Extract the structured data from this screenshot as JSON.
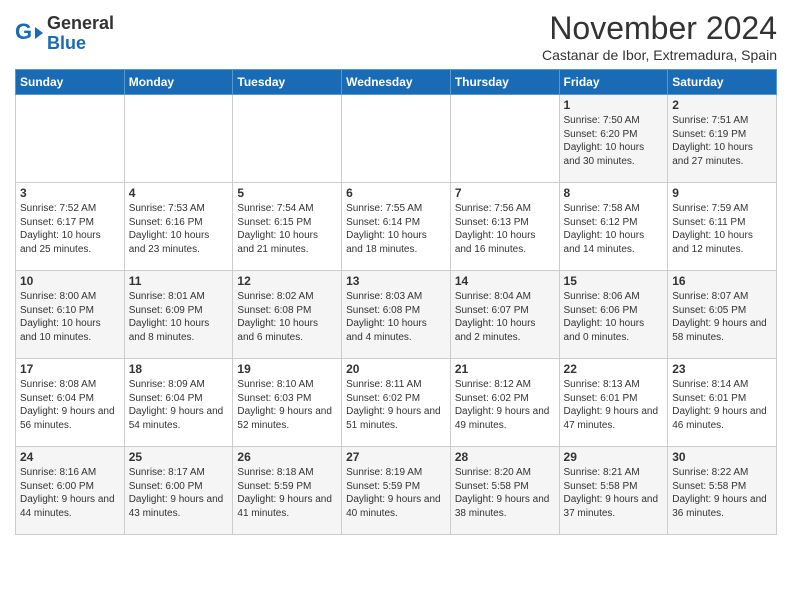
{
  "header": {
    "logo_general": "General",
    "logo_blue": "Blue",
    "title": "November 2024",
    "location": "Castanar de Ibor, Extremadura, Spain"
  },
  "days_of_week": [
    "Sunday",
    "Monday",
    "Tuesday",
    "Wednesday",
    "Thursday",
    "Friday",
    "Saturday"
  ],
  "weeks": [
    [
      {
        "day": "",
        "info": ""
      },
      {
        "day": "",
        "info": ""
      },
      {
        "day": "",
        "info": ""
      },
      {
        "day": "",
        "info": ""
      },
      {
        "day": "",
        "info": ""
      },
      {
        "day": "1",
        "info": "Sunrise: 7:50 AM\nSunset: 6:20 PM\nDaylight: 10 hours and 30 minutes."
      },
      {
        "day": "2",
        "info": "Sunrise: 7:51 AM\nSunset: 6:19 PM\nDaylight: 10 hours and 27 minutes."
      }
    ],
    [
      {
        "day": "3",
        "info": "Sunrise: 7:52 AM\nSunset: 6:17 PM\nDaylight: 10 hours and 25 minutes."
      },
      {
        "day": "4",
        "info": "Sunrise: 7:53 AM\nSunset: 6:16 PM\nDaylight: 10 hours and 23 minutes."
      },
      {
        "day": "5",
        "info": "Sunrise: 7:54 AM\nSunset: 6:15 PM\nDaylight: 10 hours and 21 minutes."
      },
      {
        "day": "6",
        "info": "Sunrise: 7:55 AM\nSunset: 6:14 PM\nDaylight: 10 hours and 18 minutes."
      },
      {
        "day": "7",
        "info": "Sunrise: 7:56 AM\nSunset: 6:13 PM\nDaylight: 10 hours and 16 minutes."
      },
      {
        "day": "8",
        "info": "Sunrise: 7:58 AM\nSunset: 6:12 PM\nDaylight: 10 hours and 14 minutes."
      },
      {
        "day": "9",
        "info": "Sunrise: 7:59 AM\nSunset: 6:11 PM\nDaylight: 10 hours and 12 minutes."
      }
    ],
    [
      {
        "day": "10",
        "info": "Sunrise: 8:00 AM\nSunset: 6:10 PM\nDaylight: 10 hours and 10 minutes."
      },
      {
        "day": "11",
        "info": "Sunrise: 8:01 AM\nSunset: 6:09 PM\nDaylight: 10 hours and 8 minutes."
      },
      {
        "day": "12",
        "info": "Sunrise: 8:02 AM\nSunset: 6:08 PM\nDaylight: 10 hours and 6 minutes."
      },
      {
        "day": "13",
        "info": "Sunrise: 8:03 AM\nSunset: 6:08 PM\nDaylight: 10 hours and 4 minutes."
      },
      {
        "day": "14",
        "info": "Sunrise: 8:04 AM\nSunset: 6:07 PM\nDaylight: 10 hours and 2 minutes."
      },
      {
        "day": "15",
        "info": "Sunrise: 8:06 AM\nSunset: 6:06 PM\nDaylight: 10 hours and 0 minutes."
      },
      {
        "day": "16",
        "info": "Sunrise: 8:07 AM\nSunset: 6:05 PM\nDaylight: 9 hours and 58 minutes."
      }
    ],
    [
      {
        "day": "17",
        "info": "Sunrise: 8:08 AM\nSunset: 6:04 PM\nDaylight: 9 hours and 56 minutes."
      },
      {
        "day": "18",
        "info": "Sunrise: 8:09 AM\nSunset: 6:04 PM\nDaylight: 9 hours and 54 minutes."
      },
      {
        "day": "19",
        "info": "Sunrise: 8:10 AM\nSunset: 6:03 PM\nDaylight: 9 hours and 52 minutes."
      },
      {
        "day": "20",
        "info": "Sunrise: 8:11 AM\nSunset: 6:02 PM\nDaylight: 9 hours and 51 minutes."
      },
      {
        "day": "21",
        "info": "Sunrise: 8:12 AM\nSunset: 6:02 PM\nDaylight: 9 hours and 49 minutes."
      },
      {
        "day": "22",
        "info": "Sunrise: 8:13 AM\nSunset: 6:01 PM\nDaylight: 9 hours and 47 minutes."
      },
      {
        "day": "23",
        "info": "Sunrise: 8:14 AM\nSunset: 6:01 PM\nDaylight: 9 hours and 46 minutes."
      }
    ],
    [
      {
        "day": "24",
        "info": "Sunrise: 8:16 AM\nSunset: 6:00 PM\nDaylight: 9 hours and 44 minutes."
      },
      {
        "day": "25",
        "info": "Sunrise: 8:17 AM\nSunset: 6:00 PM\nDaylight: 9 hours and 43 minutes."
      },
      {
        "day": "26",
        "info": "Sunrise: 8:18 AM\nSunset: 5:59 PM\nDaylight: 9 hours and 41 minutes."
      },
      {
        "day": "27",
        "info": "Sunrise: 8:19 AM\nSunset: 5:59 PM\nDaylight: 9 hours and 40 minutes."
      },
      {
        "day": "28",
        "info": "Sunrise: 8:20 AM\nSunset: 5:58 PM\nDaylight: 9 hours and 38 minutes."
      },
      {
        "day": "29",
        "info": "Sunrise: 8:21 AM\nSunset: 5:58 PM\nDaylight: 9 hours and 37 minutes."
      },
      {
        "day": "30",
        "info": "Sunrise: 8:22 AM\nSunset: 5:58 PM\nDaylight: 9 hours and 36 minutes."
      }
    ]
  ]
}
